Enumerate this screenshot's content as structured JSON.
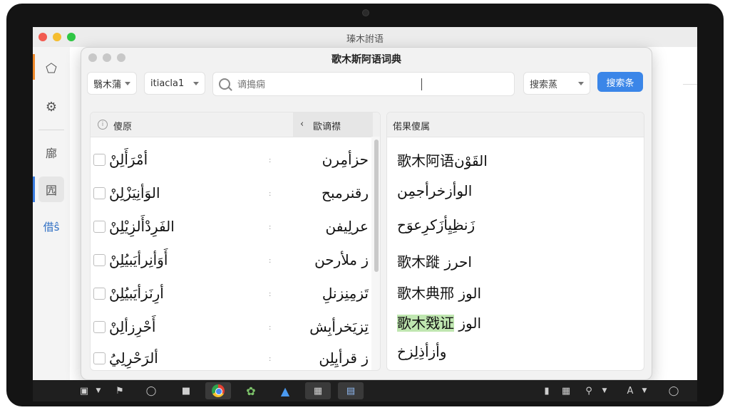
{
  "outer_window": {
    "title": "瑧木詂语"
  },
  "sidebar": {
    "items": [
      {
        "icon": "tag-icon",
        "glyph": "⬠"
      },
      {
        "icon": "gear-icon",
        "glyph": "⚙"
      },
      {
        "label": "廍"
      },
      {
        "label": "囥"
      },
      {
        "label": "借ŝ"
      }
    ]
  },
  "dictionary": {
    "title": "歌木斯阿语词典",
    "toolbar": {
      "source_lang": "翳木蒲",
      "mode": "itiacla1",
      "search_placeholder": "谪搗痫",
      "search_value": "",
      "search_type": "搜索蒸",
      "search_button": "搜索条"
    },
    "left_panel": {
      "header": "傻原",
      "header_right": "歐谪襟",
      "rows": [
        {
          "term": "أمْرَأَلِنْ",
          "trans": "ح‍زأمِرن"
        },
        {
          "term": "الوَأنِيَزْلِنْ",
          "trans": "رقن‍رمبح"
        },
        {
          "term": "الفَرِدْأَلزِيْلِنْ",
          "trans": "ع‍رلِيفن"
        },
        {
          "term": "أَوَأنِرأيَبيُلِنْ",
          "trans": "ز ملأرحن"
        },
        {
          "term": "أرِنَزأيَبيُلِنْ",
          "trans": "تَزمِنِزنلِ"
        },
        {
          "term": "أَحْرِزألِنْ",
          "trans": "تِزيَخرأبِش"
        },
        {
          "term": "ألرَحْرِلِيُ",
          "trans": "ز قرأيِلِن"
        }
      ]
    },
    "right_panel": {
      "header": "偌果傻属",
      "results": [
        "歌木阿语القَوْن",
        "الوأزخرأجمِن",
        "زَنظِيِأزَكرِعوَح",
        "歌木蹝 احرز",
        "歌木典邢 الوز",
        "歌木戣证 الوز",
        "وأزأذِلِزخ"
      ],
      "highlight_index": 5,
      "highlight_text": "歌木戣证"
    }
  },
  "taskbar": {
    "icons": [
      "chart-icon",
      "chevron-down-icon",
      "flag-icon",
      "bell-icon",
      "video-icon",
      "chrome-icon",
      "photos-icon",
      "store-icon",
      "window-icon",
      "file-icon",
      "signal-icon",
      "grid-icon",
      "search-icon",
      "chevron-down-icon",
      "font-icon",
      "chevron-down-icon",
      "circle-icon"
    ]
  },
  "colors": {
    "accent_blue": "#3b86e8",
    "sidebar_accent_orange": "#f08a2c",
    "highlight_green": "#bfe6b0"
  }
}
